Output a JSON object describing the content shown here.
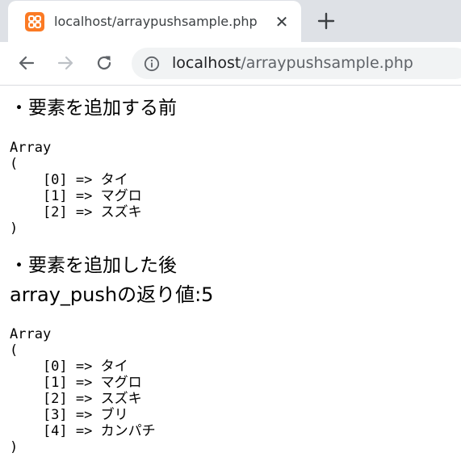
{
  "tab": {
    "title": "localhost/arraypushsample.php",
    "close_glyph": "✕",
    "favicon_icon": "xampp-icon"
  },
  "toolbar": {
    "url_host": "localhost",
    "url_path": "/arraypushsample.php"
  },
  "page": {
    "before_heading": "・要素を追加する前",
    "before_array": {
      "open_word": "Array",
      "open_paren": "(",
      "items": [
        "    [0] => タイ",
        "    [1] => マグロ",
        "    [2] => スズキ"
      ],
      "close_paren": ")"
    },
    "after_heading": "・要素を追加した後",
    "return_line": "array_pushの返り値:5",
    "after_array": {
      "open_word": "Array",
      "open_paren": "(",
      "items": [
        "    [0] => タイ",
        "    [1] => マグロ",
        "    [2] => スズキ",
        "    [3] => ブリ",
        "    [4] => カンパチ"
      ],
      "close_paren": ")"
    }
  },
  "colors": {
    "tabstrip": "#dee1e6",
    "favicon": "#fb7a24",
    "omnibox": "#f1f3f4"
  }
}
